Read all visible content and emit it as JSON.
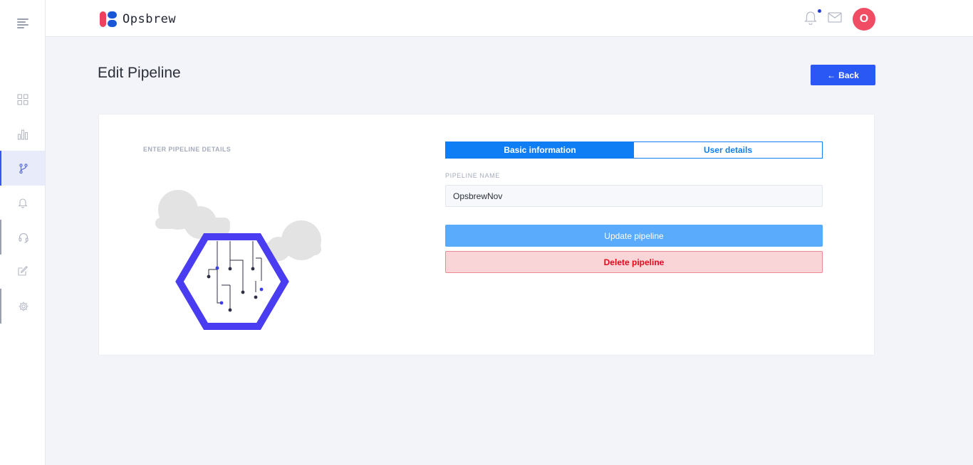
{
  "app": {
    "logo_text": "Opsbrew"
  },
  "sidebar": {
    "menu_icon": "hamburger-icon",
    "items": [
      {
        "icon": "dashboard-grid-icon"
      },
      {
        "icon": "bar-chart-icon"
      },
      {
        "icon": "git-branch-icon",
        "active": true
      },
      {
        "icon": "bell-icon"
      },
      {
        "icon": "headset-icon"
      },
      {
        "icon": "edit-icon"
      },
      {
        "icon": "settings-icon"
      }
    ]
  },
  "header": {
    "notification_icon": "bell-icon",
    "notification_dot_color": "#1f3bd6",
    "mail_icon": "mail-icon",
    "avatar_initial": "O",
    "avatar_color": "#f04d64"
  },
  "page": {
    "title": "Edit Pipeline",
    "back_button": "Back",
    "back_icon": "arrow-left-icon"
  },
  "form": {
    "section_label": "ENTER PIPELINE DETAILS",
    "tabs": [
      {
        "label": "Basic information",
        "active": true
      },
      {
        "label": "User details",
        "active": false
      }
    ],
    "pipeline_name_label": "PIPELINE NAME",
    "pipeline_name_value": "OpsbrewNov",
    "update_button": "Update pipeline",
    "delete_button": "Delete pipeline"
  },
  "colors": {
    "primary": "#2a58f5",
    "tab_blue": "#0f7ef5",
    "update_blue": "#5aabfb",
    "danger_text": "#e3071a",
    "danger_bg": "#f9d5d7"
  }
}
